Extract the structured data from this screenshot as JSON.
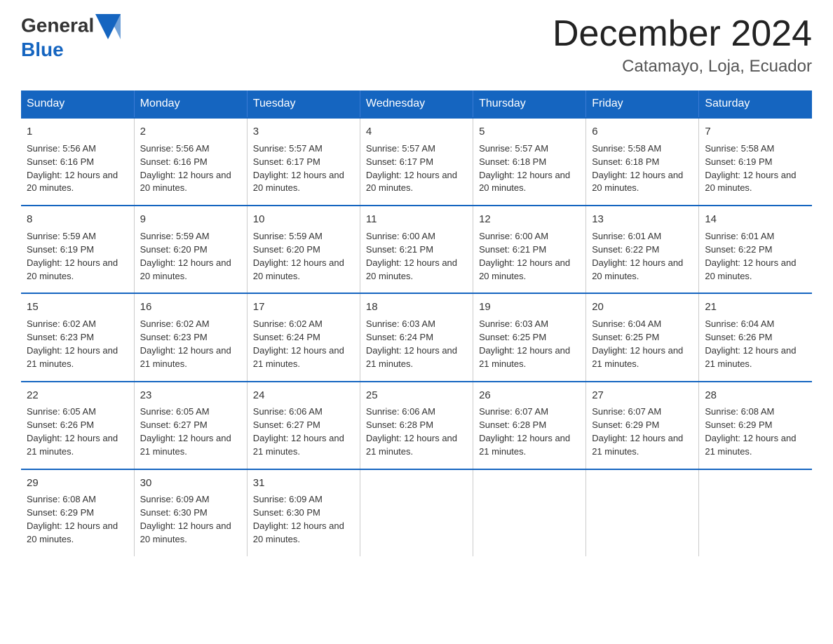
{
  "header": {
    "logo_general": "General",
    "logo_blue": "Blue",
    "month_title": "December 2024",
    "location": "Catamayo, Loja, Ecuador"
  },
  "weekdays": [
    "Sunday",
    "Monday",
    "Tuesday",
    "Wednesday",
    "Thursday",
    "Friday",
    "Saturday"
  ],
  "weeks": [
    [
      {
        "day": "1",
        "sunrise": "Sunrise: 5:56 AM",
        "sunset": "Sunset: 6:16 PM",
        "daylight": "Daylight: 12 hours and 20 minutes."
      },
      {
        "day": "2",
        "sunrise": "Sunrise: 5:56 AM",
        "sunset": "Sunset: 6:16 PM",
        "daylight": "Daylight: 12 hours and 20 minutes."
      },
      {
        "day": "3",
        "sunrise": "Sunrise: 5:57 AM",
        "sunset": "Sunset: 6:17 PM",
        "daylight": "Daylight: 12 hours and 20 minutes."
      },
      {
        "day": "4",
        "sunrise": "Sunrise: 5:57 AM",
        "sunset": "Sunset: 6:17 PM",
        "daylight": "Daylight: 12 hours and 20 minutes."
      },
      {
        "day": "5",
        "sunrise": "Sunrise: 5:57 AM",
        "sunset": "Sunset: 6:18 PM",
        "daylight": "Daylight: 12 hours and 20 minutes."
      },
      {
        "day": "6",
        "sunrise": "Sunrise: 5:58 AM",
        "sunset": "Sunset: 6:18 PM",
        "daylight": "Daylight: 12 hours and 20 minutes."
      },
      {
        "day": "7",
        "sunrise": "Sunrise: 5:58 AM",
        "sunset": "Sunset: 6:19 PM",
        "daylight": "Daylight: 12 hours and 20 minutes."
      }
    ],
    [
      {
        "day": "8",
        "sunrise": "Sunrise: 5:59 AM",
        "sunset": "Sunset: 6:19 PM",
        "daylight": "Daylight: 12 hours and 20 minutes."
      },
      {
        "day": "9",
        "sunrise": "Sunrise: 5:59 AM",
        "sunset": "Sunset: 6:20 PM",
        "daylight": "Daylight: 12 hours and 20 minutes."
      },
      {
        "day": "10",
        "sunrise": "Sunrise: 5:59 AM",
        "sunset": "Sunset: 6:20 PM",
        "daylight": "Daylight: 12 hours and 20 minutes."
      },
      {
        "day": "11",
        "sunrise": "Sunrise: 6:00 AM",
        "sunset": "Sunset: 6:21 PM",
        "daylight": "Daylight: 12 hours and 20 minutes."
      },
      {
        "day": "12",
        "sunrise": "Sunrise: 6:00 AM",
        "sunset": "Sunset: 6:21 PM",
        "daylight": "Daylight: 12 hours and 20 minutes."
      },
      {
        "day": "13",
        "sunrise": "Sunrise: 6:01 AM",
        "sunset": "Sunset: 6:22 PM",
        "daylight": "Daylight: 12 hours and 20 minutes."
      },
      {
        "day": "14",
        "sunrise": "Sunrise: 6:01 AM",
        "sunset": "Sunset: 6:22 PM",
        "daylight": "Daylight: 12 hours and 20 minutes."
      }
    ],
    [
      {
        "day": "15",
        "sunrise": "Sunrise: 6:02 AM",
        "sunset": "Sunset: 6:23 PM",
        "daylight": "Daylight: 12 hours and 21 minutes."
      },
      {
        "day": "16",
        "sunrise": "Sunrise: 6:02 AM",
        "sunset": "Sunset: 6:23 PM",
        "daylight": "Daylight: 12 hours and 21 minutes."
      },
      {
        "day": "17",
        "sunrise": "Sunrise: 6:02 AM",
        "sunset": "Sunset: 6:24 PM",
        "daylight": "Daylight: 12 hours and 21 minutes."
      },
      {
        "day": "18",
        "sunrise": "Sunrise: 6:03 AM",
        "sunset": "Sunset: 6:24 PM",
        "daylight": "Daylight: 12 hours and 21 minutes."
      },
      {
        "day": "19",
        "sunrise": "Sunrise: 6:03 AM",
        "sunset": "Sunset: 6:25 PM",
        "daylight": "Daylight: 12 hours and 21 minutes."
      },
      {
        "day": "20",
        "sunrise": "Sunrise: 6:04 AM",
        "sunset": "Sunset: 6:25 PM",
        "daylight": "Daylight: 12 hours and 21 minutes."
      },
      {
        "day": "21",
        "sunrise": "Sunrise: 6:04 AM",
        "sunset": "Sunset: 6:26 PM",
        "daylight": "Daylight: 12 hours and 21 minutes."
      }
    ],
    [
      {
        "day": "22",
        "sunrise": "Sunrise: 6:05 AM",
        "sunset": "Sunset: 6:26 PM",
        "daylight": "Daylight: 12 hours and 21 minutes."
      },
      {
        "day": "23",
        "sunrise": "Sunrise: 6:05 AM",
        "sunset": "Sunset: 6:27 PM",
        "daylight": "Daylight: 12 hours and 21 minutes."
      },
      {
        "day": "24",
        "sunrise": "Sunrise: 6:06 AM",
        "sunset": "Sunset: 6:27 PM",
        "daylight": "Daylight: 12 hours and 21 minutes."
      },
      {
        "day": "25",
        "sunrise": "Sunrise: 6:06 AM",
        "sunset": "Sunset: 6:28 PM",
        "daylight": "Daylight: 12 hours and 21 minutes."
      },
      {
        "day": "26",
        "sunrise": "Sunrise: 6:07 AM",
        "sunset": "Sunset: 6:28 PM",
        "daylight": "Daylight: 12 hours and 21 minutes."
      },
      {
        "day": "27",
        "sunrise": "Sunrise: 6:07 AM",
        "sunset": "Sunset: 6:29 PM",
        "daylight": "Daylight: 12 hours and 21 minutes."
      },
      {
        "day": "28",
        "sunrise": "Sunrise: 6:08 AM",
        "sunset": "Sunset: 6:29 PM",
        "daylight": "Daylight: 12 hours and 21 minutes."
      }
    ],
    [
      {
        "day": "29",
        "sunrise": "Sunrise: 6:08 AM",
        "sunset": "Sunset: 6:29 PM",
        "daylight": "Daylight: 12 hours and 20 minutes."
      },
      {
        "day": "30",
        "sunrise": "Sunrise: 6:09 AM",
        "sunset": "Sunset: 6:30 PM",
        "daylight": "Daylight: 12 hours and 20 minutes."
      },
      {
        "day": "31",
        "sunrise": "Sunrise: 6:09 AM",
        "sunset": "Sunset: 6:30 PM",
        "daylight": "Daylight: 12 hours and 20 minutes."
      },
      {
        "day": "",
        "sunrise": "",
        "sunset": "",
        "daylight": ""
      },
      {
        "day": "",
        "sunrise": "",
        "sunset": "",
        "daylight": ""
      },
      {
        "day": "",
        "sunrise": "",
        "sunset": "",
        "daylight": ""
      },
      {
        "day": "",
        "sunrise": "",
        "sunset": "",
        "daylight": ""
      }
    ]
  ]
}
